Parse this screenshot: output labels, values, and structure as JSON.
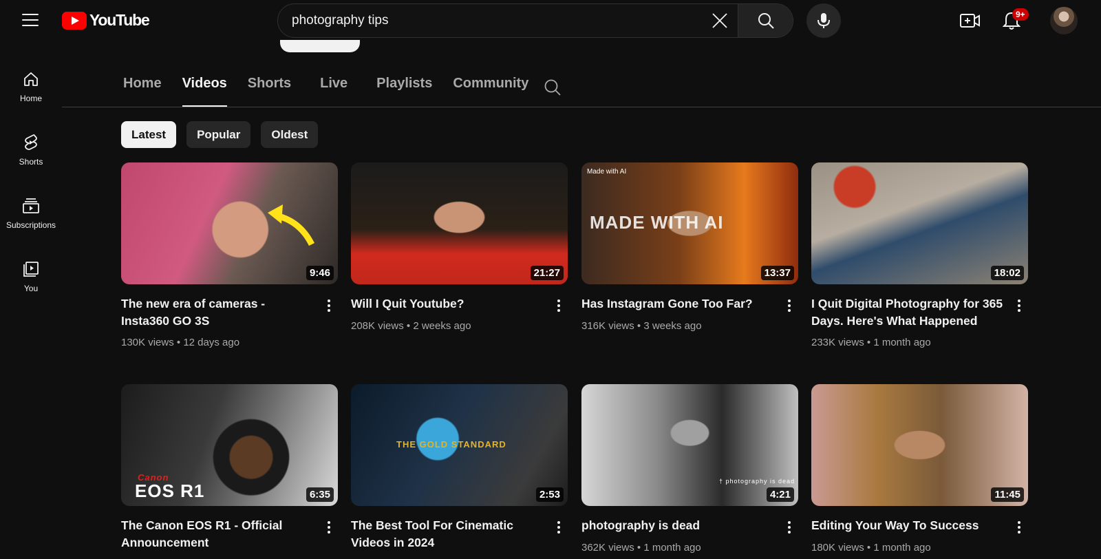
{
  "header": {
    "logo_text": "YouTube",
    "search_value": "photography tips",
    "notification_count": "9+"
  },
  "sidebar": {
    "items": [
      {
        "label": "Home"
      },
      {
        "label": "Shorts"
      },
      {
        "label": "Subscriptions"
      },
      {
        "label": "You"
      }
    ]
  },
  "tabs": [
    {
      "label": "Home"
    },
    {
      "label": "Videos"
    },
    {
      "label": "Shorts"
    },
    {
      "label": "Live"
    },
    {
      "label": "Playlists"
    },
    {
      "label": "Community"
    }
  ],
  "chips": [
    {
      "label": "Latest"
    },
    {
      "label": "Popular"
    },
    {
      "label": "Oldest"
    }
  ],
  "videos": [
    {
      "title": "The new era of cameras - Insta360 GO 3S",
      "views": "130K views",
      "age": "12 days ago",
      "duration": "9:46"
    },
    {
      "title": "Will I Quit Youtube?",
      "views": "208K views",
      "age": "2 weeks ago",
      "duration": "21:27"
    },
    {
      "title": "Has Instagram Gone Too Far?",
      "views": "316K views",
      "age": "3 weeks ago",
      "duration": "13:37",
      "badge": "Made with AI",
      "overlay": "MADE WITH AI"
    },
    {
      "title": "I Quit Digital Photography for 365 Days. Here's What Happened",
      "views": "233K views",
      "age": "1 month ago",
      "duration": "18:02"
    },
    {
      "title": "The Canon EOS R1 - Official Announcement",
      "views": "",
      "age": "",
      "duration": "6:35",
      "overlay": "EOS R1",
      "overlay2": "Canon"
    },
    {
      "title": "The Best Tool For Cinematic Videos in 2024",
      "views": "",
      "age": "",
      "duration": "2:53",
      "overlay": "THE GOLD STANDARD"
    },
    {
      "title": "photography is dead",
      "views": "362K views",
      "age": "1 month ago",
      "duration": "4:21",
      "overlay": "† photography is dead"
    },
    {
      "title": "Editing Your Way To Success",
      "views": "180K views",
      "age": "1 month ago",
      "duration": "11:45"
    }
  ],
  "meta_separator": "•"
}
